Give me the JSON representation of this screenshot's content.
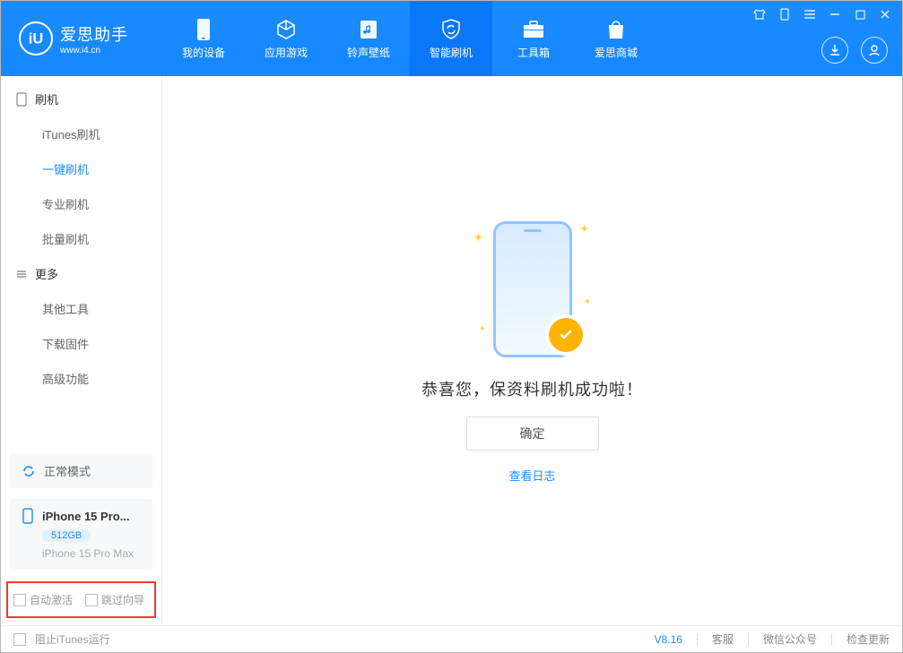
{
  "app": {
    "title": "爱思助手",
    "subtitle": "www.i4.cn"
  },
  "nav": {
    "items": [
      {
        "label": "我的设备"
      },
      {
        "label": "应用游戏"
      },
      {
        "label": "铃声壁纸"
      },
      {
        "label": "智能刷机"
      },
      {
        "label": "工具箱"
      },
      {
        "label": "爱思商城"
      }
    ]
  },
  "sidebar": {
    "group1": {
      "title": "刷机",
      "items": [
        "iTunes刷机",
        "一键刷机",
        "专业刷机",
        "批量刷机"
      ]
    },
    "group2": {
      "title": "更多",
      "items": [
        "其他工具",
        "下载固件",
        "高级功能"
      ]
    }
  },
  "mode": {
    "label": "正常模式"
  },
  "device": {
    "name": "iPhone 15 Pro...",
    "storage": "512GB",
    "model": "iPhone 15 Pro Max"
  },
  "highlight": {
    "auto_activate": "自动激活",
    "skip_guide": "跳过向导"
  },
  "main": {
    "success": "恭喜您，保资料刷机成功啦！",
    "ok": "确定",
    "log": "查看日志"
  },
  "footer": {
    "block_itunes": "阻止iTunes运行",
    "version": "V8.16",
    "support": "客服",
    "wechat": "微信公众号",
    "update": "检查更新"
  }
}
